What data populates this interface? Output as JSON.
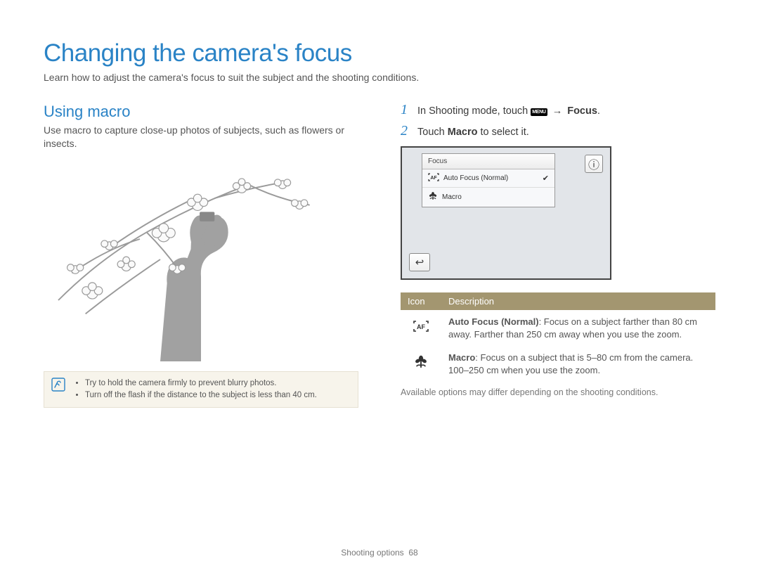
{
  "page_title": "Changing the camera's focus",
  "page_subtitle": "Learn how to adjust the camera's focus to suit the subject and the shooting conditions.",
  "left": {
    "heading": "Using macro",
    "body": "Use macro to capture close-up photos of subjects, such as flowers or insects.",
    "tips": [
      "Try to hold the camera firmly to prevent blurry photos.",
      "Turn off the flash if the distance to the subject is less than 40 cm."
    ]
  },
  "steps": {
    "s1_prefix": "In Shooting mode, touch ",
    "s1_menu_chip": "MENU",
    "s1_arrow": "→",
    "s1_bold": "Focus",
    "s1_suffix": ".",
    "s2_prefix": "Touch ",
    "s2_bold": "Macro",
    "s2_suffix": " to select it."
  },
  "screen": {
    "menu_title": "Focus",
    "item1": "Auto Focus (Normal)",
    "item2": "Macro",
    "info_glyph": "ⓘ",
    "back_glyph": "↩"
  },
  "table": {
    "col_icon": "Icon",
    "col_desc": "Description",
    "row1_bold": "Auto Focus (Normal)",
    "row1_rest": ": Focus on a subject farther than 80 cm away. Farther than 250 cm away when you use the zoom.",
    "row2_bold": "Macro",
    "row2_rest": ": Focus on a subject that is 5–80 cm from the camera. 100–250 cm when you use the zoom."
  },
  "caption": "Available options may differ depending on the shooting conditions.",
  "footer_section": "Shooting options",
  "footer_page": "68"
}
